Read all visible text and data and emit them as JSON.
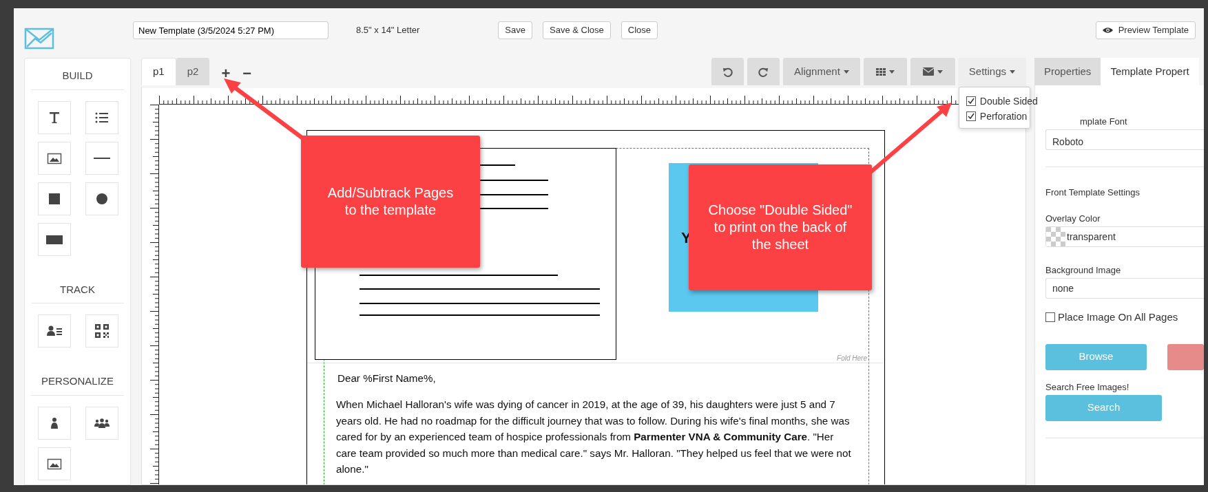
{
  "header": {
    "template_name": "New Template (3/5/2024 5:27 PM)",
    "paper_size": "8.5\" x 14\" Letter",
    "buttons": [
      "Save",
      "Save & Close",
      "Close"
    ],
    "preview_button": "Preview Template"
  },
  "tool_sections": [
    {
      "title": "BUILD",
      "tools": [
        {
          "kind": "text"
        },
        {
          "kind": "list"
        },
        {
          "kind": "image"
        },
        {
          "kind": "line"
        },
        {
          "kind": "square"
        },
        {
          "kind": "circle"
        },
        {
          "kind": "rectangle"
        }
      ]
    },
    {
      "title": "TRACK",
      "tools": [
        {
          "kind": "contact"
        },
        {
          "kind": "qr"
        }
      ]
    },
    {
      "title": "PERSONALIZE",
      "tools": [
        {
          "kind": "person"
        },
        {
          "kind": "group"
        },
        {
          "kind": "image"
        }
      ]
    }
  ],
  "page_tabs": [
    {
      "label": "p1",
      "selected": true
    },
    {
      "label": "p2",
      "selected": false
    }
  ],
  "page_actions": [
    "+",
    "−"
  ],
  "toolbar": [
    {
      "kind": "undo"
    },
    {
      "kind": "redo"
    },
    {
      "kind": "dropdown",
      "label": "Alignment",
      "expanded": false
    },
    {
      "kind": "grid"
    },
    {
      "kind": "mail"
    },
    {
      "kind": "dropdown",
      "label": "Settings",
      "expanded": true
    }
  ],
  "settings_menu": [
    {
      "label": "Double Sided",
      "checked": true
    },
    {
      "label": "Perforation",
      "checked": true
    }
  ],
  "panel_tabs": [
    {
      "label": "Properties",
      "selected": false
    },
    {
      "label": "Template Propert",
      "selected": true
    }
  ],
  "properties": {
    "font_label": "mplate Font",
    "font_value": "Roboto",
    "section_title": "Front Template Settings",
    "overlay_label": "Overlay Color",
    "overlay_value": "transparent",
    "background_label": "Background Image",
    "background_value": "none",
    "place_on_all": {
      "label": "Place Image On All Pages",
      "checked": false
    },
    "browse_button": "Browse",
    "search_label": "Search Free Images!",
    "search_button": "Search"
  },
  "letter": {
    "panel_text": "Y",
    "fold_label": "Fold Here",
    "greeting": "Dear %First Name%,",
    "body": "When Michael Halloran's wife was dying of cancer in 2019, at the age of 39, his daughters were just 5 and 7 years old. He had no roadmap for the difficult journey that was to follow. During his wife's final months, she was cared for by an experienced team of hospice professionals from **Parmenter VNA & Community Care**. \"Her care team provided so much more than medical care.\" says Mr. Halloran. \"They helped us feel that we were not alone.\""
  },
  "callouts": [
    {
      "text": "Add/Subtrack Pages to the template"
    },
    {
      "text": "Choose \"Double Sided\" to print on the back of the sheet"
    }
  ]
}
